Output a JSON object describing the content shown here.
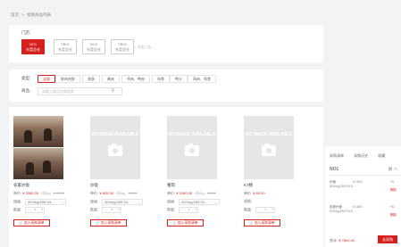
{
  "breadcrumb": {
    "home": "首页",
    "current": "批发商品列表"
  },
  "store": {
    "label": "门店:",
    "buttons": [
      {
        "line1": "NO1",
        "line2": "东莞总仓",
        "active": true
      },
      {
        "line1": "TB01",
        "line2": "东莞总仓",
        "active": false
      },
      {
        "line1": "NO2",
        "line2": "东莞总仓",
        "active": false
      },
      {
        "line1": "TB02",
        "line2": "东莞总仓",
        "active": false
      }
    ],
    "add_label": "+ 添加门店"
  },
  "filter": {
    "type_label": "类型:",
    "chips": [
      "全部",
      "鲜肉热鲜",
      "香肠",
      "酱肉",
      "鸡肉、鸭肉",
      "排骨",
      "鸭头",
      "熟肉、熟食"
    ],
    "name_label": "商品:",
    "search_placeholder": "请输入商品名称搜索"
  },
  "products": [
    {
      "name": "农家炒饭",
      "price_label": "单价:",
      "price": "¥ 2080.00",
      "unit": "/份/kg",
      "strike": "¥ 1000",
      "spec_label": "规格:",
      "spec_value": "80%kg/280*24...",
      "qty_label": "数量:",
      "qty_value": "1",
      "add_label": "加入采购清单"
    },
    {
      "name": "炒饭",
      "price_label": "单价:",
      "price": "¥ 800.00",
      "unit": "/份/kg",
      "strike": "¥ 100",
      "spec_label": "规格:",
      "spec_value": "80%kg/280*24...",
      "qty_label": "数量:",
      "qty_value": "1",
      "add_label": "加入采购清单"
    },
    {
      "name": "猪肉",
      "price_label": "单价:",
      "price": "¥ 1080.00",
      "unit": "/份/kg",
      "strike": "¥ 100",
      "spec_label": "规格:",
      "spec_value": "80%kg/280*22...",
      "qty_label": "数量:",
      "qty_value": "1",
      "add_label": "加入采购清单"
    },
    {
      "name": "K7肠",
      "price_label": "单价:",
      "price": "¥ 60.00",
      "unit": "",
      "strike": "",
      "spec_label": "规格:",
      "spec_value": "",
      "qty_label": "数量:",
      "qty_value": "1",
      "add_label": "加入采购清单"
    }
  ],
  "no_image_text": "NO IMAGE AVAILABLE",
  "panel": {
    "tabs": [
      "采购清单",
      "采购历史",
      "收藏"
    ],
    "store_name": "NO1",
    "ops": "删 ∧",
    "items": [
      {
        "name": "炒饭",
        "price": "¥ 1800",
        "spec": "80%kg/280*24.8...",
        "action": "+1",
        "delete": "删除"
      },
      {
        "name": "农家炒饭",
        "price": "¥ 1800",
        "spec": "80%kg/280*24.8...",
        "action": "+1",
        "delete": "删除"
      }
    ],
    "total_label": "合计:",
    "total_value": "¥ 7800.00",
    "submit_label": "去采购"
  },
  "colors": {
    "accent": "#d5201d",
    "background": "#f2f3f5"
  },
  "icons": {
    "search": "search-icon",
    "camera": "camera-icon"
  }
}
